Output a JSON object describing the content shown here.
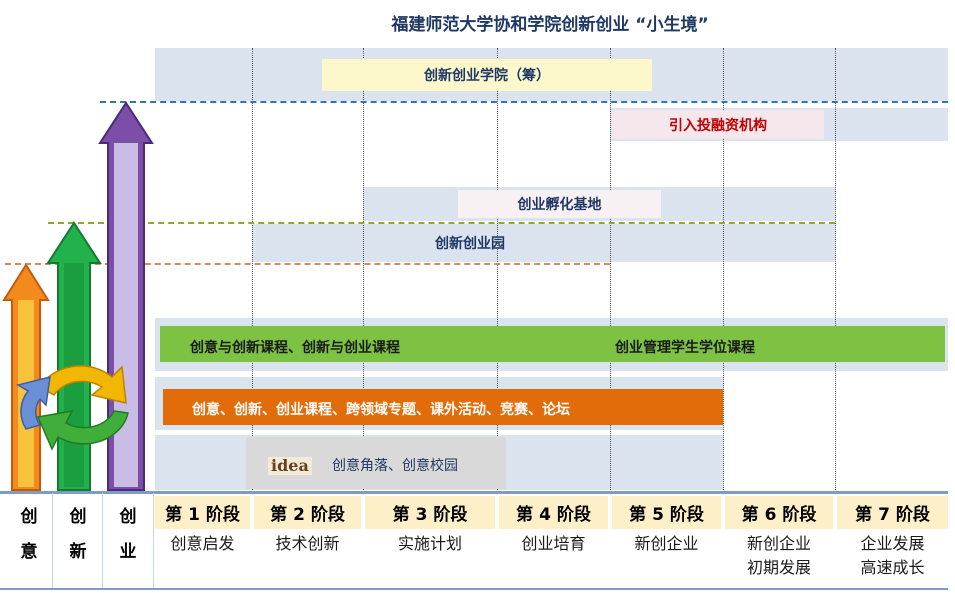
{
  "title": "福建师范大学协和学院创新创业 “小生境”",
  "boxes": {
    "academy": "创新创业学院（筹）",
    "investment": "引入投融资机构",
    "incubator": "创业孵化基地",
    "park": "创新创业园"
  },
  "courses": {
    "green_left": "创意与创新课程、创新与创业课程",
    "green_right": "创业管理学生学位课程",
    "orange": "创意、创新、创业课程、跨领域专题、课外活动、竞赛、论坛",
    "idea_logo": "idea",
    "idea_text": "创意角落、创意校园"
  },
  "left_labels": [
    {
      "top": "创",
      "bottom": "意"
    },
    {
      "top": "创",
      "bottom": "新"
    },
    {
      "top": "创",
      "bottom": "业"
    }
  ],
  "stages": [
    {
      "head": "第 1 阶段",
      "line1": "创意启发",
      "line2": ""
    },
    {
      "head": "第 2 阶段",
      "line1": "技术创新",
      "line2": ""
    },
    {
      "head": "第 3 阶段",
      "line1": "实施计划",
      "line2": ""
    },
    {
      "head": "第 4 阶段",
      "line1": "创业培育",
      "line2": ""
    },
    {
      "head": "第 5 阶段",
      "line1": "新创企业",
      "line2": ""
    },
    {
      "head": "第 6 阶段",
      "line1": "新创企业",
      "line2": "初期发展"
    },
    {
      "head": "第 7 阶段",
      "line1": "企业发展",
      "line2": "高速成长"
    }
  ],
  "colors": {
    "band": "#dbe3ef",
    "arrow_orange": "#f28a1e",
    "arrow_green": "#22b24c",
    "arrow_purple": "#7b4fa8",
    "course_green": "#7dc243",
    "course_orange": "#e36c0a",
    "stage_head": "#fdf0c9"
  }
}
